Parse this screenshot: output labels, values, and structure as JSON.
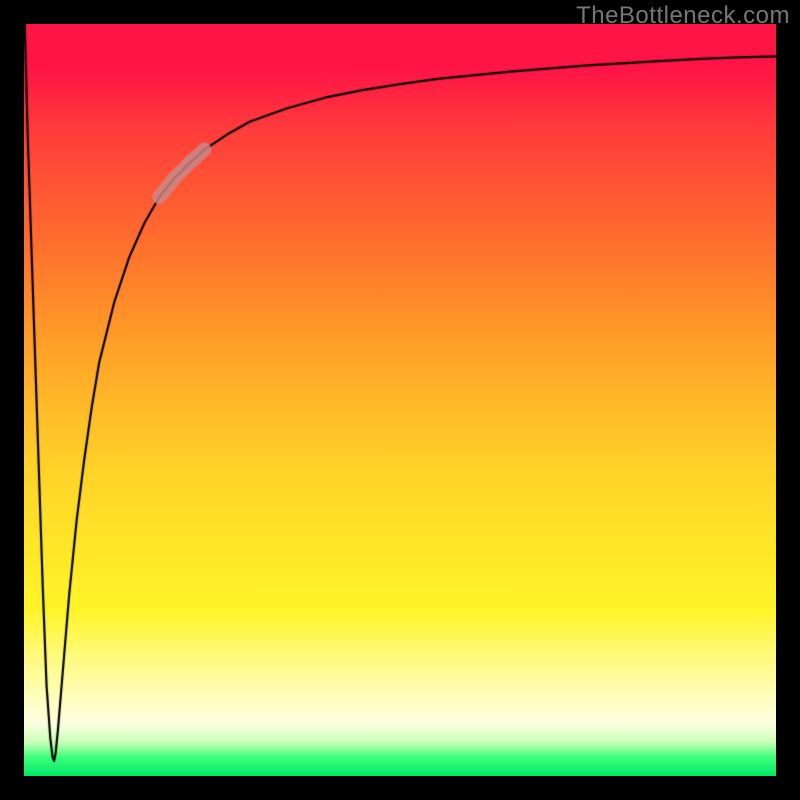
{
  "watermark": "TheBottleneck.com",
  "chart_data": {
    "type": "line",
    "title": "",
    "xlabel": "",
    "ylabel": "",
    "xlim": [
      0,
      100
    ],
    "ylim": [
      0,
      100
    ],
    "grid": false,
    "legend": false,
    "x": [
      0.1,
      0.5,
      1.0,
      1.5,
      2.0,
      2.5,
      3.0,
      3.5,
      3.8,
      4.0,
      4.2,
      4.5,
      5.0,
      6.0,
      7.0,
      8.0,
      9.0,
      10.0,
      12.0,
      14.0,
      16.0,
      18.0,
      20.0,
      22.0,
      24.0,
      27.0,
      30.0,
      35.0,
      40.0,
      45.0,
      50.0,
      55.0,
      60.0,
      65.0,
      70.0,
      75.0,
      80.0,
      85.0,
      90.0,
      95.0,
      100.0
    ],
    "y": [
      100.0,
      85.0,
      70.0,
      55.0,
      40.0,
      25.0,
      12.0,
      5.0,
      2.5,
      2.0,
      3.0,
      6.0,
      12.0,
      24.0,
      34.0,
      42.0,
      49.0,
      55.0,
      63.0,
      69.0,
      73.5,
      77.0,
      79.5,
      81.5,
      83.3,
      85.3,
      87.0,
      88.8,
      90.2,
      91.2,
      92.0,
      92.7,
      93.2,
      93.7,
      94.1,
      94.5,
      94.8,
      95.1,
      95.35,
      95.55,
      95.7
    ],
    "highlight": {
      "color": "#c98a8a",
      "x_start": 18.0,
      "x_end": 24.0
    },
    "gradient_stops": [
      {
        "pos": 0,
        "color": "#ff1446"
      },
      {
        "pos": 50,
        "color": "#ffc828"
      },
      {
        "pos": 85,
        "color": "#fffc60"
      },
      {
        "pos": 100,
        "color": "#00e868"
      }
    ]
  }
}
